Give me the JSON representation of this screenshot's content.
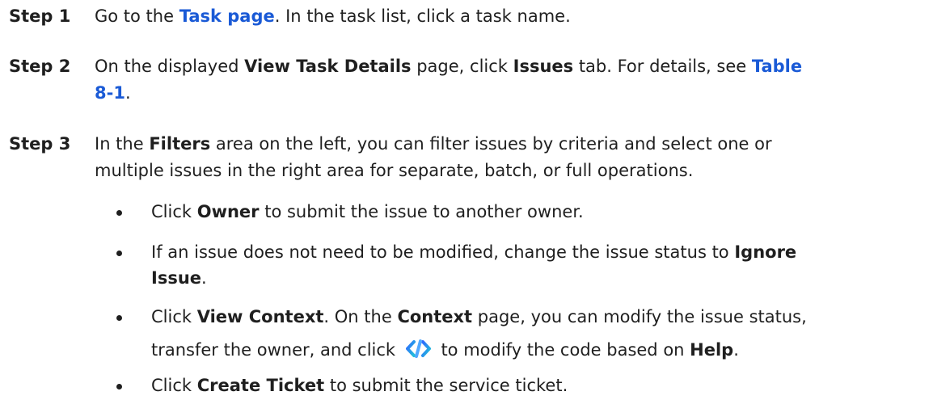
{
  "step1": {
    "label": "Step 1",
    "text_before": "Go to the ",
    "link": "Task page",
    "text_after": ". In the task list, click a task name."
  },
  "step2": {
    "label": "Step 2",
    "text1": "On the displayed ",
    "bold1": "View Task Details",
    "text2": " page, click ",
    "bold2": "Issues",
    "text3": " tab. For details, see ",
    "link_part1": "Table",
    "link_part2": "8-1",
    "text4": "."
  },
  "step3": {
    "label": "Step 3",
    "line1_text1": "In the ",
    "line1_bold": "Filters",
    "line1_text2": " area on the left, you can filter issues by criteria and select one or",
    "line2": "multiple issues in the right area for separate, batch, or full operations."
  },
  "bullets": {
    "b1_text1": "Click ",
    "b1_bold": "Owner",
    "b1_text2": " to submit the issue to another owner.",
    "b2_line1_text": "If an issue does not need to be modified, change the issue status to ",
    "b2_line1_bold": "Ignore",
    "b2_line2_bold": "Issue",
    "b2_line2_text": ".",
    "b3_line1_text1": "Click ",
    "b3_line1_bold1": "View Context",
    "b3_line1_text2": ". On the ",
    "b3_line1_bold2": "Context",
    "b3_line1_text3": " page, you can modify the issue status,",
    "b3_line2_text1": "transfer the owner, and click ",
    "b3_line2_icon": "code-fix-icon",
    "b3_line2_text2": " to modify the code based on ",
    "b3_line2_bold": "Help",
    "b3_line2_text3": ".",
    "b4_text1": "Click ",
    "b4_bold": "Create Ticket",
    "b4_text2": " to submit the service ticket."
  },
  "colors": {
    "link": "#1a5ad6",
    "text": "#1f1f1f",
    "icon_gradient_start": "#2f6bff",
    "icon_gradient_end": "#21c0d8"
  }
}
